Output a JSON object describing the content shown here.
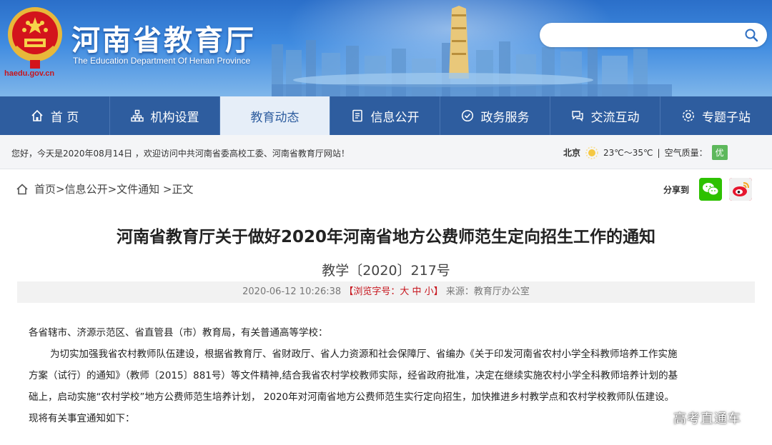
{
  "header": {
    "url": "haedu.gov.cn",
    "title": "河南省教育厅",
    "subtitle": "The Education Department Of Henan Province"
  },
  "search": {
    "placeholder": ""
  },
  "nav": {
    "items": [
      {
        "label": "首 页",
        "icon": "home-icon"
      },
      {
        "label": "机构设置",
        "icon": "org-icon"
      },
      {
        "label": "教育动态",
        "icon": "",
        "active": true
      },
      {
        "label": "信息公开",
        "icon": "document-icon"
      },
      {
        "label": "政务服务",
        "icon": "service-icon"
      },
      {
        "label": "交流互动",
        "icon": "chat-icon"
      },
      {
        "label": "专题子站",
        "icon": "topic-icon"
      }
    ]
  },
  "greeting": {
    "text": "您好，今天是2020年08月14日 ，欢迎访问中共河南省委高校工委、河南省教育厅网站！",
    "city": "北京",
    "temp": "23℃～35℃",
    "aq_label": "空气质量：",
    "aq_value": "优",
    "aq_color": "#5db85c"
  },
  "breadcrumb": {
    "home": "首页",
    "path": " >信息公开>文件通知 >正文"
  },
  "share": {
    "label": "分享到"
  },
  "article": {
    "title": "河南省教育厅关于做好2020年河南省地方公费师范生定向招生工作的通知",
    "doc_number": "教学〔2020〕217号",
    "datetime": "2020-06-12 10:26:38",
    "font_size_prefix": "【浏览字号：",
    "font_big": "大",
    "font_mid": "中",
    "font_small": "小",
    "font_size_suffix": "】",
    "source": "来源：教育厅办公室",
    "paragraphs": [
      "各省辖市、济源示范区、省直管县（市）教育局，有关普通高等学校：",
      "为切实加强我省农村教师队伍建设，根据省教育厅、省财政厅、省人力资源和社会保障厅、省编办《关于印发河南省农村小学全科教师培养工作实施",
      "方案（试行）的通知》（教师〔2015〕881号）等文件精神,结合我省农村学校教师实际，经省政府批准，决定在继续实施农村小学全科教师培养计划的基",
      "础上，启动实施“农村学校”地方公费师范生培养计划， 2020年对河南省地方公费师范生实行定向招生，加快推进乡村教学点和农村学校教师队伍建设。",
      "现将有关事宜通知如下："
    ]
  },
  "watermark": "高考直通车"
}
